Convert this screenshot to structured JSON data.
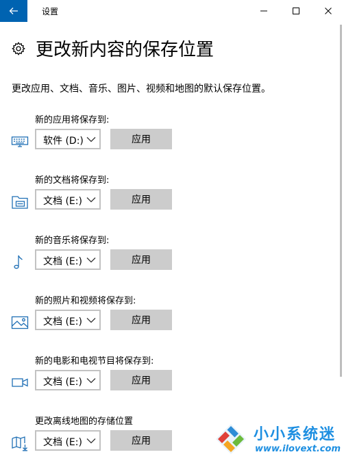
{
  "window": {
    "title": "设置",
    "accent_color": "#0063b1"
  },
  "page": {
    "title": "更改新内容的保存位置",
    "description": "更改应用、文档、音乐、图片、视频和地图的默认保存位置。"
  },
  "sections": [
    {
      "label": "新的应用将保存到:",
      "icon": "monitor-icon",
      "drive": "软件 (D:)",
      "apply_label": "应用"
    },
    {
      "label": "新的文档将保存到:",
      "icon": "documents-drive-icon",
      "drive": "文档 (E:)",
      "apply_label": "应用"
    },
    {
      "label": "新的音乐将保存到:",
      "icon": "music-note-icon",
      "drive": "文档 (E:)",
      "apply_label": "应用"
    },
    {
      "label": "新的照片和视频将保存到:",
      "icon": "picture-icon",
      "drive": "文档 (E:)",
      "apply_label": "应用"
    },
    {
      "label": "新的电影和电视节目将保存到:",
      "icon": "video-camera-icon",
      "drive": "文档 (E:)",
      "apply_label": "应用"
    },
    {
      "label": "更改离线地图的存储位置",
      "icon": "map-download-icon",
      "drive": "文档 (E:)",
      "apply_label": "应用"
    }
  ],
  "watermark": {
    "title": "小小系统迷",
    "url": "www.ilovext.com"
  }
}
